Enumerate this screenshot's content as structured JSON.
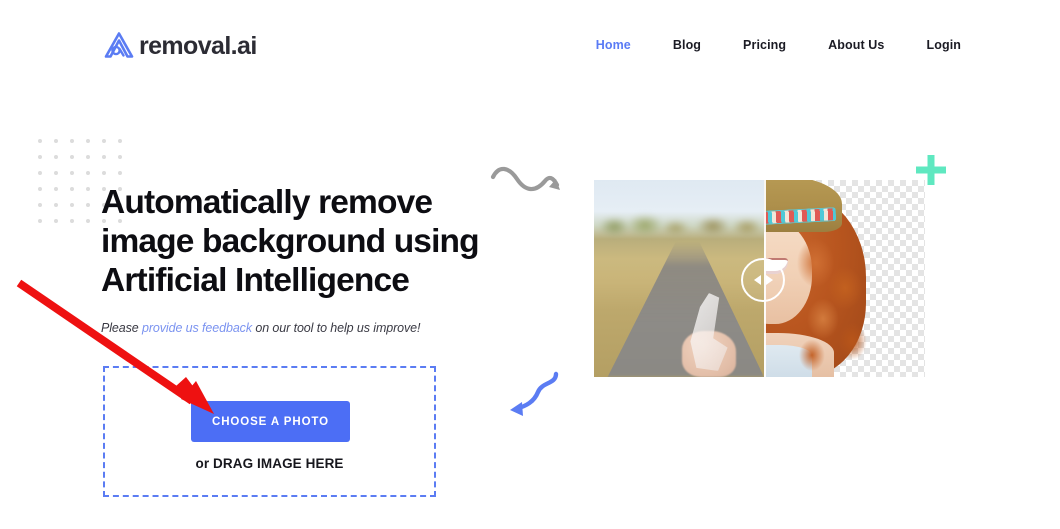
{
  "header": {
    "logo": {
      "mark_name": "removal-ai-logo-mark",
      "text": "removal.ai",
      "mark_color": "#5b7cf3",
      "text_color": "#2c2c34"
    },
    "nav": {
      "items": [
        {
          "label": "Home",
          "active": true
        },
        {
          "label": "Blog",
          "active": false
        },
        {
          "label": "Pricing",
          "active": false
        },
        {
          "label": "About Us",
          "active": false
        },
        {
          "label": "Login",
          "active": false
        }
      ],
      "active_color": "#5a7bf5",
      "inactive_color": "#1b1b24"
    }
  },
  "hero": {
    "headline_line1": "Automatically remove",
    "headline_line2": "image background using",
    "headline_line3": "Artificial Intelligence",
    "subhead_prefix": "Please ",
    "subhead_link": "provide us feedback",
    "subhead_suffix": " on our tool to help us improve!",
    "link_color": "#7b93f0"
  },
  "uploader": {
    "button_label": "CHOOSE A PHOTO",
    "button_color": "#4c6ef5",
    "drag_label": "or DRAG IMAGE HERE",
    "dropzone_border_color": "#5b7cf3",
    "dropzone_border_style": "dashed"
  },
  "preview": {
    "comparison_label": "before-after-slider",
    "before_side": "original photo of woman on a road",
    "after_side": "transparent checkerboard background",
    "handle_icon": "left-right-arrows-icon",
    "checker_light": "#ffffff",
    "checker_dark": "#e4e4e4"
  },
  "decorations": {
    "dot_grid_color": "#dcdcdc",
    "dot_grid_cols": 6,
    "dot_grid_rows": 6,
    "wavy_arrow_color": "#9a9a9a",
    "blue_arrow_color": "#5b7cf3",
    "plus_color": "#5fe8c0"
  },
  "annotation": {
    "arrow_color": "#ee1111",
    "arrow_target": "choose-a-photo-button"
  }
}
